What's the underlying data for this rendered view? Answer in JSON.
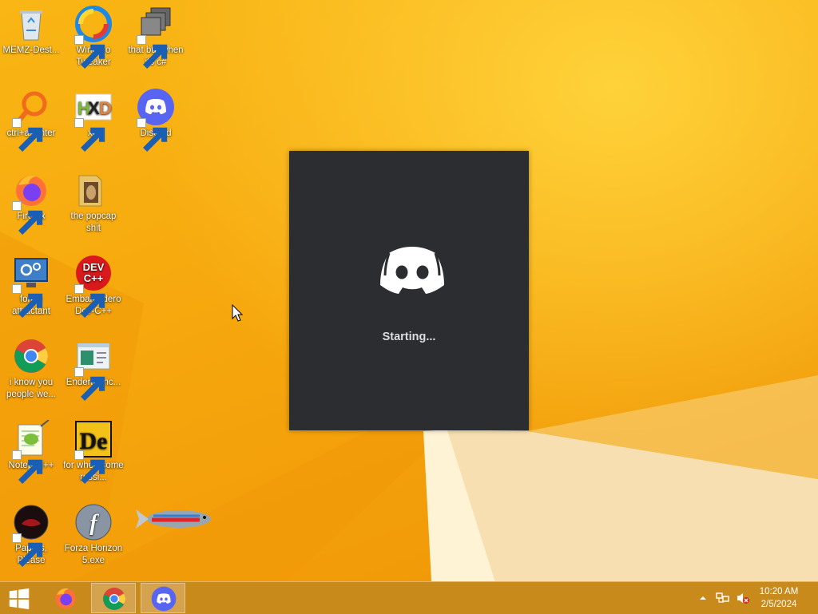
{
  "desktop": {
    "icons": [
      {
        "label": "MEMZ-Dest...",
        "icon": "recycle-bin-icon"
      },
      {
        "label": "Winaero Tweaker",
        "icon": "winaero-icon"
      },
      {
        "label": "that but when its c#",
        "icon": "stacked-windows-icon"
      },
      {
        "label": "ctrl+a, enter",
        "icon": "magnifier-icon"
      },
      {
        "label": "xD",
        "icon": "hxd-icon"
      },
      {
        "label": "Discord",
        "icon": "discord-icon"
      },
      {
        "label": "Firefox",
        "icon": "firefox-icon"
      },
      {
        "label": "the popcap shit",
        "icon": "folder-icon"
      },
      {
        "label": "forkie attractant",
        "icon": "computer-settings-icon"
      },
      {
        "label": "Embarcadero Dev-C++",
        "icon": "devcpp-icon"
      },
      {
        "label": "i know you people we...",
        "icon": "chrome-icon"
      },
      {
        "label": "Endermanc...",
        "icon": "window-app-icon"
      },
      {
        "label": "Notepad++",
        "icon": "notepadpp-icon"
      },
      {
        "label": "for when some russi...",
        "icon": "de-icon"
      },
      {
        "label": "Papers, Please",
        "icon": "papers-please-icon"
      },
      {
        "label": "Forza Horizon 5.exe",
        "icon": "flash-icon"
      }
    ]
  },
  "splash": {
    "app": "Discord",
    "status": "Starting..."
  },
  "taskbar": {
    "apps": [
      "Firefox",
      "Google Chrome",
      "Discord"
    ],
    "clock": {
      "time": "10:20 AM",
      "date": "2/5/2024"
    }
  },
  "colors": {
    "wallpaper": "#f6a70d",
    "splash_bg": "#2b2d31",
    "discord_blurple": "#5865f2",
    "taskbar": "#c98a1c"
  }
}
